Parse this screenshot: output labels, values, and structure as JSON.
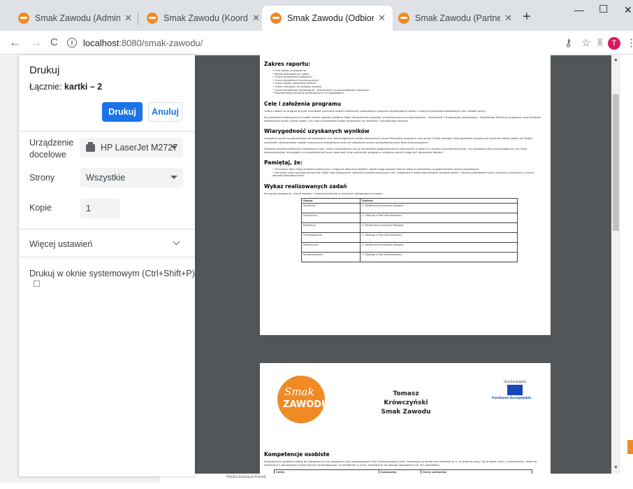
{
  "tabs": [
    {
      "title": "Smak Zawodu (Administrator)",
      "active": false
    },
    {
      "title": "Smak Zawodu (Koordynator)",
      "active": false
    },
    {
      "title": "Smak Zawodu (Odbiorca)",
      "active": true
    },
    {
      "title": "Smak Zawodu (Partner)",
      "active": false
    }
  ],
  "toolbar": {
    "back": "←",
    "forward": "→",
    "reload": "C",
    "url_host": "localhost",
    "url_path": ":8080/smak-zawodu/",
    "avatar_letter": "T"
  },
  "print_dialog": {
    "title": "Drukuj",
    "total_label": "Łącznie:",
    "total_value": "kartki – 2",
    "print_button": "Drukuj",
    "cancel_button": "Anuluj",
    "destination_label": "Urządzenie docelowe",
    "destination_value": "HP LaserJet M2727",
    "pages_label": "Strony",
    "pages_value": "Wszystkie",
    "copies_label": "Kopie",
    "copies_value": "1",
    "more_settings": "Więcej ustawień",
    "system_dialog": "Drukuj w oknie systemowym (Ctrl+Shift+P)"
  },
  "preview": {
    "report_scope_heading": "Zakres raportu:",
    "report_scope_items": [
      "Cele udziału w programie",
      "Wykaz realizowanych zadań",
      "Ocena kompetencji osobistych",
      "Ocena kompetencji merytorycznych",
      "Ocena jakości wykonania zadania",
      "Ocena motywacji do realizacji zadania",
      "Ocena kompetencji wykonawcze – biznesowych w poszczególnych obszarach",
      "Rekomendacja odnośnie preferowanych ról zawodowych"
    ],
    "goals_heading": "Cele i założenia programu",
    "goals_text_1": "Celem udziału w programie była możliwość poznania swoich preferencji zawodowych poprzez wykonywanie zadań z różnych obszarów zawodowych tzw. próbek pracy.",
    "goals_text_2": "Na podstawie realizowanych zadań ocenie zostały poddane Twoje kompetencje osobiste, merytoryczne oraz wykonawcze – biznesowe z 6 obszarów zawodowych. Dodatkowo Partnerzy programu ocenili jakość wykonanych przez Ciebie zadań, a ty sam oceniałeś/aś swoją motywację do realizacji z określonego obszaru.",
    "reliability_heading": "Wiarygodność uzyskanych wyników",
    "reliability_text_1": "Uzyskane wyniki są generowane na podstawie ocen poszczególnych zadań dokonanych przez Partnerów programu oraz przez Ciebie samego. Wiarygodność uzyskanych wyników zależy zatem od Twojej szczerości ustosunkowań wobec ocenianych kompetencji oraz od rzetelności oceny wystawionej przez Partnerów programu.",
    "reliability_text_2": "Zarówno ankieta preferencji zawodowych jak i oceny kompetencji nie są narzędziem diagnostycznym tworzonym w oparciu o kryteria psychometryczne, nie posiadają testy psychologiczne czy testy kompetencyjne, ze względu na subiektywność ocen ewaluacji oraz partnerów programu uzyskane wyniki mogą być obarczone błędem.",
    "remember_heading": "Pamiętaj, że:",
    "remember_items": [
      "Otrzymane dane mają charakter orientacyjny, mogą być obarczone błędem, zatem mogą stanowić jedynie jedną ze wskazówek w podejmowaniu decyzji zawodowych.",
      "Jeśli jakaś część wyników stanowi dla Ciebie duże zaskoczenie, zarówno w sensie pozytywnym jak i negatywnym warto skonsultować uzyskane wyniki z doradcą zawodowym oraz z wynikami uzyskanymi z innych narzędzi diagnostycznych."
    ],
    "tasks_heading": "Wykaz realizowanych zadań",
    "tasks_intro": "W ramach programu „Smak zawodu” uczestniczyłeś/aś w realizacji następujących zadań:",
    "table_headers": [
      "Obszar",
      "Zadania"
    ],
    "table_rows": [
      [
        "Społeczny",
        "1. Wydarzenie przyjazne Wiejgina"
      ],
      [
        "Artystyczny",
        "1. Obsługa z Flow dokumentamy"
      ],
      [
        "Badawczy",
        "1. Wydarzenie przyjazne Wiejgina"
      ],
      [
        "Przedsiębiorczy",
        "1. Obsługa z Flow dokumentamy"
      ],
      [
        "Realistyczny",
        "1. Wydarzenie przyjazne Wiejgina"
      ],
      [
        "Konwencjonalny",
        "1. Obsługa z Flow dokumentamy"
      ]
    ],
    "logo_line1": "Smak",
    "logo_line2": "ZAWODU",
    "person_name": "Tomasz Krówczyński",
    "program_name": "Smak Zawodu",
    "eu_label": "Unia Europejska",
    "funds_label": "Fundusze Europejskie",
    "personal_heading": "Kompetencje osobiste",
    "personal_text": "Kompetencje osobiste należą do kompetencji tzw. bazowych czyli podstawowych dla funkcjonowania ludzi. Pozwalają na skuteczne działanie m.in. w dziwnie pracy. Są to takie cechy i umiejętności, które są atrakcyjne z perspektywy potencjalnych pracodawców, są niezbędne w pracy niezależnie od danego stanowiska czy roli zawodowej.",
    "personal_table_headers": [
      "Cecha",
      "Samoocena",
      "Oceny partnerów"
    ],
    "footer_text": "Wiedza Edukacja Rozwój"
  },
  "colors": {
    "accent": "#1a73e8",
    "brand_orange": "#f08a24",
    "preview_bg": "#525659",
    "avatar": "#d81b60"
  }
}
